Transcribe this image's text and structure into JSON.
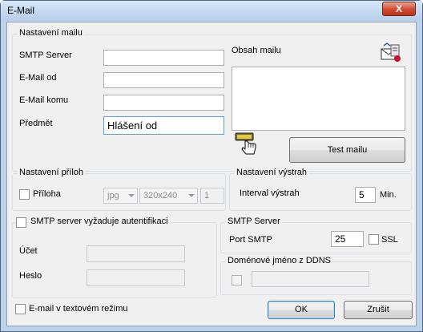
{
  "window": {
    "title": "E-Mail",
    "close_label": "X"
  },
  "mail_settings": {
    "legend": "Nastavení mailu",
    "smtp_server_label": "SMTP Server",
    "smtp_server_value": "",
    "email_from_label": "E-Mail od",
    "email_from_value": "",
    "email_to_label": "E-Mail komu",
    "email_to_value": "",
    "subject_label": "Předmět",
    "subject_value": "Hlášení od",
    "content_label": "Obsah mailu",
    "content_value": "",
    "test_button": "Test mailu"
  },
  "attachments": {
    "legend": "Nastavení příloh",
    "attachment_label": "Příloha",
    "format_value": "jpg",
    "resolution_value": "320x240",
    "count_value": "1"
  },
  "alerts": {
    "legend": "Nastavení výstrah",
    "interval_label": "Interval výstrah",
    "interval_value": "5",
    "interval_unit": "Min."
  },
  "auth": {
    "legend": "SMTP server vyžaduje autentifikaci",
    "account_label": "Účet",
    "account_value": "",
    "password_label": "Heslo",
    "password_value": ""
  },
  "smtp": {
    "legend": "SMTP Server",
    "port_label": "Port SMTP",
    "port_value": "25",
    "ssl_label": "SSL"
  },
  "ddns": {
    "legend": "Doménové jméno z DDNS",
    "value": ""
  },
  "footer": {
    "text_mode_label": "E-mail v textovém režimu",
    "ok_button": "OK",
    "cancel_button": "Zrušit"
  },
  "icons": {
    "mail_icon": "mail-envelope-icon",
    "hand_icon": "hand-pointer-icon"
  }
}
